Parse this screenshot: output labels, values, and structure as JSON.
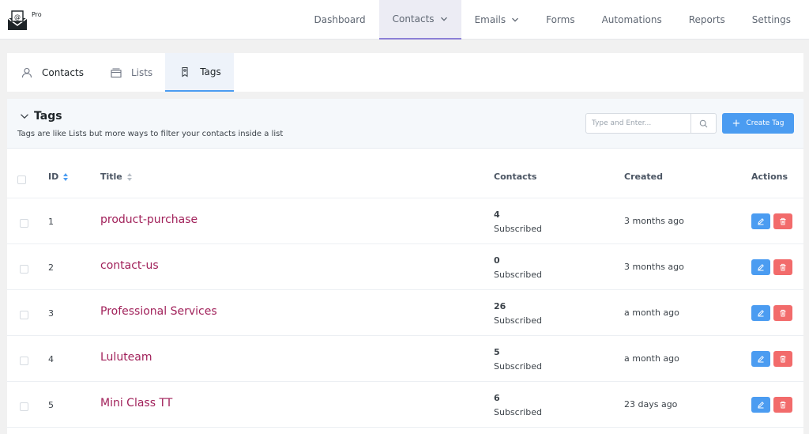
{
  "app": {
    "badge": "Pro"
  },
  "nav": {
    "items": [
      {
        "label": "Dashboard",
        "active": false,
        "dropdown": false
      },
      {
        "label": "Contacts",
        "active": true,
        "dropdown": true
      },
      {
        "label": "Emails",
        "active": false,
        "dropdown": true
      },
      {
        "label": "Forms",
        "active": false,
        "dropdown": false
      },
      {
        "label": "Automations",
        "active": false,
        "dropdown": false
      },
      {
        "label": "Reports",
        "active": false,
        "dropdown": false
      },
      {
        "label": "Settings",
        "active": false,
        "dropdown": false
      }
    ]
  },
  "subtabs": {
    "contacts": "Contacts",
    "lists": "Lists",
    "tags": "Tags"
  },
  "panel": {
    "title": "Tags",
    "subtitle": "Tags are like Lists but more ways to filter your contacts inside a list",
    "search_placeholder": "Type and Enter...",
    "create_label": "Create Tag"
  },
  "table": {
    "columns": {
      "id": "ID",
      "title": "Title",
      "contacts": "Contacts",
      "created": "Created",
      "actions": "Actions"
    },
    "rows": [
      {
        "id": "1",
        "title": "product-purchase",
        "count": "4",
        "status": "Subscribed",
        "created": "3 months ago"
      },
      {
        "id": "2",
        "title": "contact-us",
        "count": "0",
        "status": "Subscribed",
        "created": "3 months ago"
      },
      {
        "id": "3",
        "title": "Professional Services",
        "count": "26",
        "status": "Subscribed",
        "created": "a month ago"
      },
      {
        "id": "4",
        "title": "Luluteam",
        "count": "5",
        "status": "Subscribed",
        "created": "a month ago"
      },
      {
        "id": "5",
        "title": "Mini Class TT",
        "count": "6",
        "status": "Subscribed",
        "created": "23 days ago"
      }
    ]
  },
  "colors": {
    "accent": "#4b9cf1",
    "danger": "#f26b6b",
    "title_link": "#a1215a",
    "nav_active": "#8b7fd6"
  }
}
